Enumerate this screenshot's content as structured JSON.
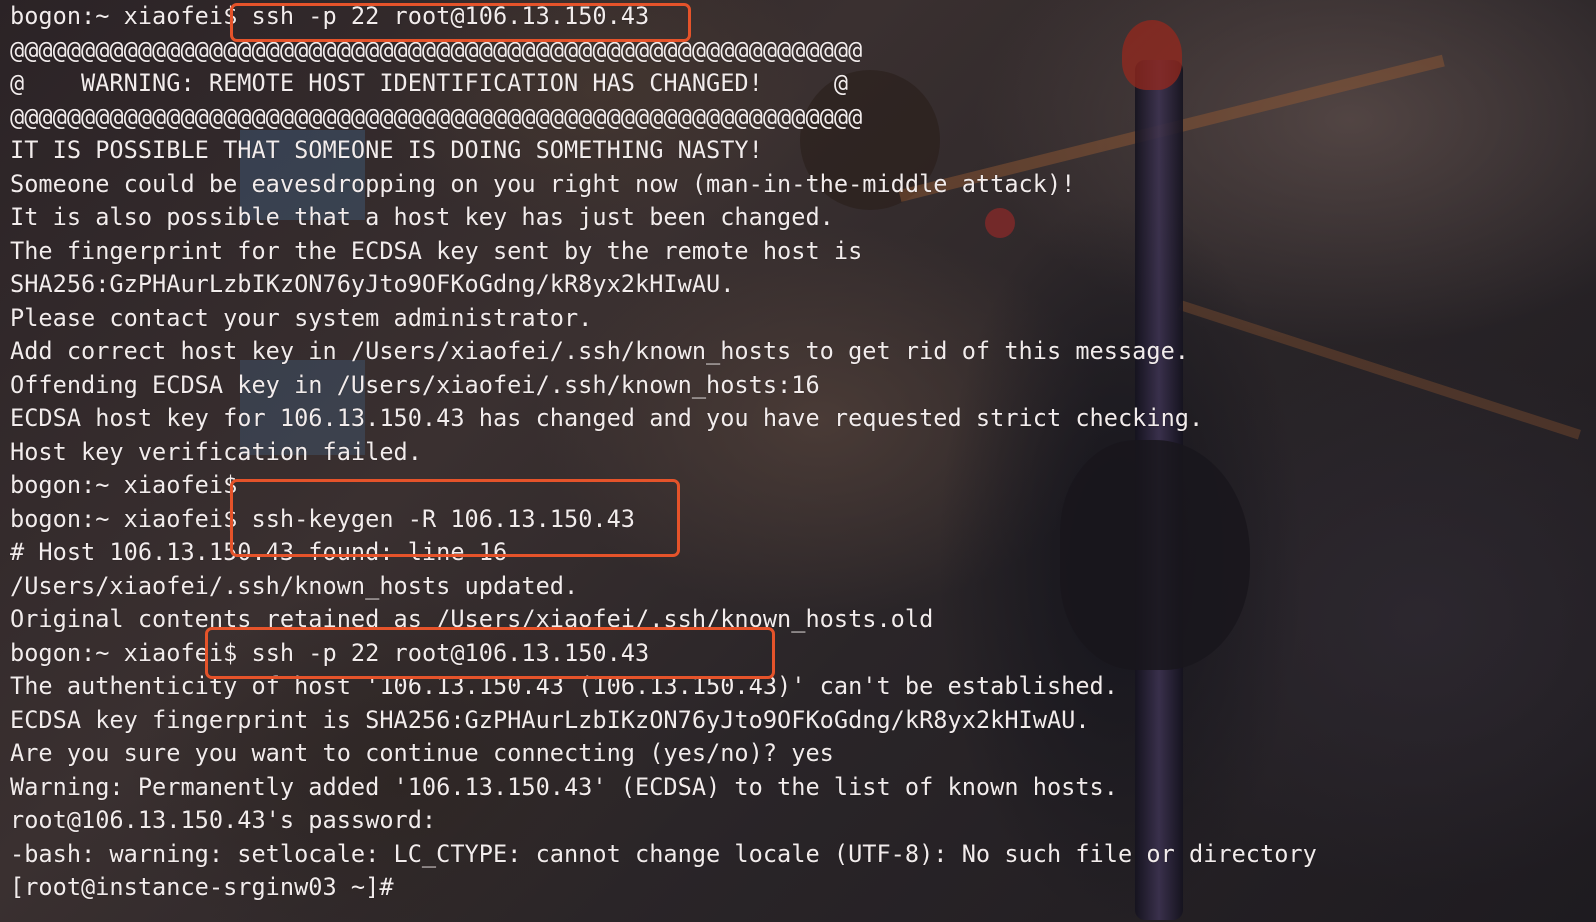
{
  "terminal": {
    "lines": [
      {
        "prompt": "bogon:~ xiaofei$ ",
        "command": "ssh -p 22 root@106.13.150.43"
      },
      {
        "text": "@@@@@@@@@@@@@@@@@@@@@@@@@@@@@@@@@@@@@@@@@@@@@@@@@@@@@@@@@@@@"
      },
      {
        "text": "@    WARNING: REMOTE HOST IDENTIFICATION HAS CHANGED!     @"
      },
      {
        "text": "@@@@@@@@@@@@@@@@@@@@@@@@@@@@@@@@@@@@@@@@@@@@@@@@@@@@@@@@@@@@"
      },
      {
        "text": "IT IS POSSIBLE THAT SOMEONE IS DOING SOMETHING NASTY!"
      },
      {
        "text": "Someone could be eavesdropping on you right now (man-in-the-middle attack)!"
      },
      {
        "text": "It is also possible that a host key has just been changed."
      },
      {
        "text": "The fingerprint for the ECDSA key sent by the remote host is"
      },
      {
        "text": "SHA256:GzPHAurLzbIKzON76yJto9OFKoGdng/kR8yx2kHIwAU."
      },
      {
        "text": "Please contact your system administrator."
      },
      {
        "text": "Add correct host key in /Users/xiaofei/.ssh/known_hosts to get rid of this message."
      },
      {
        "text": "Offending ECDSA key in /Users/xiaofei/.ssh/known_hosts:16"
      },
      {
        "text": "ECDSA host key for 106.13.150.43 has changed and you have requested strict checking."
      },
      {
        "text": "Host key verification failed."
      },
      {
        "prompt": "bogon:~ xiaofei$ ",
        "command": ""
      },
      {
        "prompt": "bogon:~ xiaofei$ ",
        "command": "ssh-keygen -R 106.13.150.43"
      },
      {
        "text": "# Host 106.13.150.43 found: line 16"
      },
      {
        "text": "/Users/xiaofei/.ssh/known_hosts updated."
      },
      {
        "text": "Original contents retained as /Users/xiaofei/.ssh/known_hosts.old"
      },
      {
        "prompt": "bogon:~ xiaofei$ ",
        "command": "ssh -p 22 root@106.13.150.43"
      },
      {
        "text": "The authenticity of host '106.13.150.43 (106.13.150.43)' can't be established."
      },
      {
        "text": "ECDSA key fingerprint is SHA256:GzPHAurLzbIKzON76yJto9OFKoGdng/kR8yx2kHIwAU."
      },
      {
        "text": "Are you sure you want to continue connecting (yes/no)? yes"
      },
      {
        "text": "Warning: Permanently added '106.13.150.43' (ECDSA) to the list of known hosts."
      },
      {
        "text": "root@106.13.150.43's password:"
      },
      {
        "text": "-bash: warning: setlocale: LC_CTYPE: cannot change locale (UTF-8): No such file or directory"
      },
      {
        "prompt": "[root@instance-srginw03 ~]# ",
        "command": ""
      }
    ]
  },
  "colors": {
    "text": "#f2ecec",
    "highlight_border": "#e5532a"
  }
}
